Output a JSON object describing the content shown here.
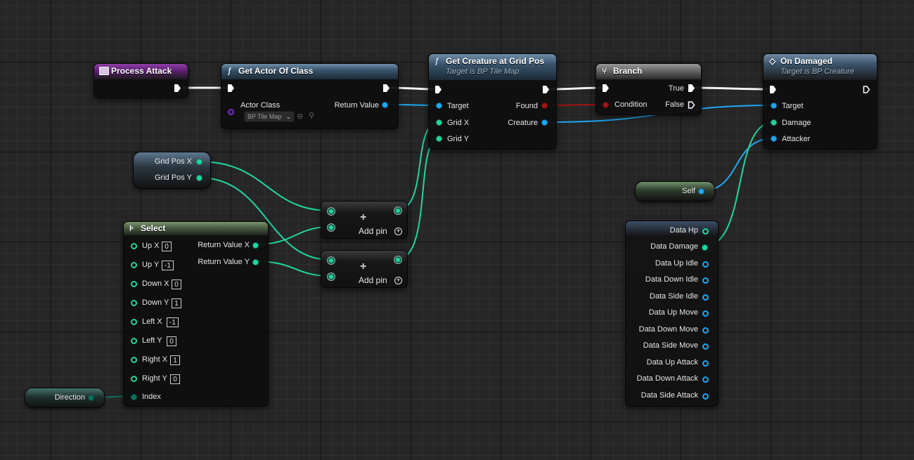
{
  "colors": {
    "exec_wire": "#f2f2f2",
    "int_wire": "#20d6a0",
    "object_wire": "#1ea8f5",
    "bool_wire": "#a41414",
    "class_pin": "#7b2ad8"
  },
  "nodes": {
    "process_attack": {
      "title": "Process Attack",
      "icon": "event-icon"
    },
    "get_actor_of_class": {
      "title": "Get Actor Of Class",
      "icon": "function-icon",
      "actor_class_label": "Actor Class",
      "actor_class_value": "BP Tile Map",
      "return_value_label": "Return Value"
    },
    "get_creature": {
      "title": "Get Creature at Grid Pos",
      "subtitle": "Target is BP Tile Map",
      "icon": "function-icon",
      "target_label": "Target",
      "grid_x_label": "Grid X",
      "grid_y_label": "Grid Y",
      "found_label": "Found",
      "creature_label": "Creature"
    },
    "branch": {
      "title": "Branch",
      "icon": "branch-icon",
      "condition_label": "Condition",
      "true_label": "True",
      "false_label": "False"
    },
    "on_damaged": {
      "title": "On Damaged",
      "subtitle": "Target is BP Creature",
      "icon": "interface-icon",
      "target_label": "Target",
      "damage_label": "Damage",
      "attacker_label": "Attacker"
    },
    "grid_pos": {
      "x_label": "Grid Pos X",
      "y_label": "Grid Pos Y"
    },
    "add1": {
      "symbol": "+",
      "add_pin_label": "Add pin"
    },
    "add2": {
      "symbol": "+",
      "add_pin_label": "Add pin"
    },
    "select": {
      "title": "Select",
      "icon": "select-icon",
      "return_x_label": "Return Value X",
      "return_y_label": "Return Value Y",
      "index_label": "Index",
      "options": [
        {
          "label": "Up X",
          "value": "0"
        },
        {
          "label": "Up Y",
          "value": "-1"
        },
        {
          "label": "Down X",
          "value": "0"
        },
        {
          "label": "Down Y",
          "value": "1"
        },
        {
          "label": "Left X",
          "value": "-1"
        },
        {
          "label": "Left Y",
          "value": "0"
        },
        {
          "label": "Right X",
          "value": "1"
        },
        {
          "label": "Right Y",
          "value": "0"
        }
      ]
    },
    "direction": {
      "label": "Direction"
    },
    "self": {
      "label": "Self"
    },
    "data_list": {
      "items": [
        "Data Hp",
        "Data Damage",
        "Data Up Idle",
        "Data Down Idle",
        "Data Side Idle",
        "Data Up Move",
        "Data Down Move",
        "Data Side Move",
        "Data Up Attack",
        "Data Down Attack",
        "Data Side Attack"
      ]
    }
  }
}
